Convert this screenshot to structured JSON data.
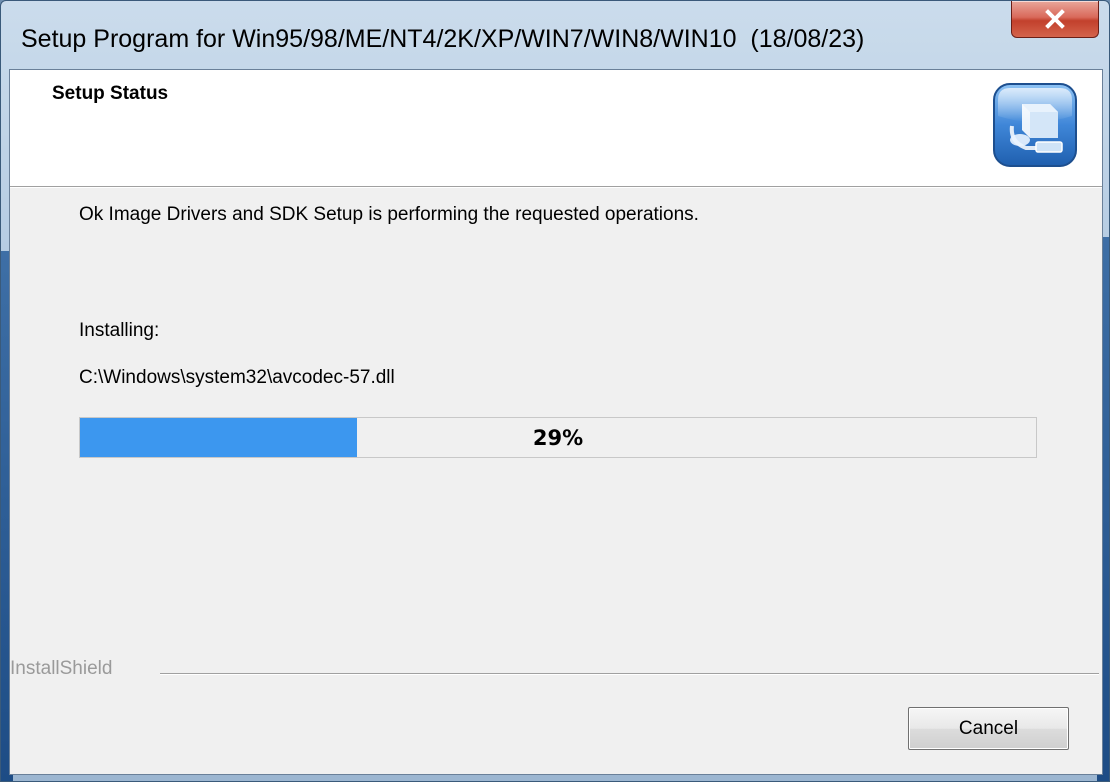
{
  "window": {
    "title": "Setup Program for Win95/98/ME/NT4/2K/XP/WIN7/WIN8/WIN10  (18/08/23)",
    "close_label": "X"
  },
  "header": {
    "title": "Setup Status",
    "icon": "setup-computer-icon"
  },
  "main": {
    "description": "Ok Image Drivers and SDK Setup is performing the requested operations.",
    "installing_label": "Installing:",
    "file_path": "C:\\Windows\\system32\\avcodec-57.dll",
    "progress": {
      "percent": 29,
      "label": "29%"
    }
  },
  "footer": {
    "brand": "InstallShield",
    "cancel_label": "Cancel"
  },
  "colors": {
    "progress_fill": "#3c97ef",
    "close_button": "#c2402c",
    "dialog_background": "#f0f0f0"
  }
}
